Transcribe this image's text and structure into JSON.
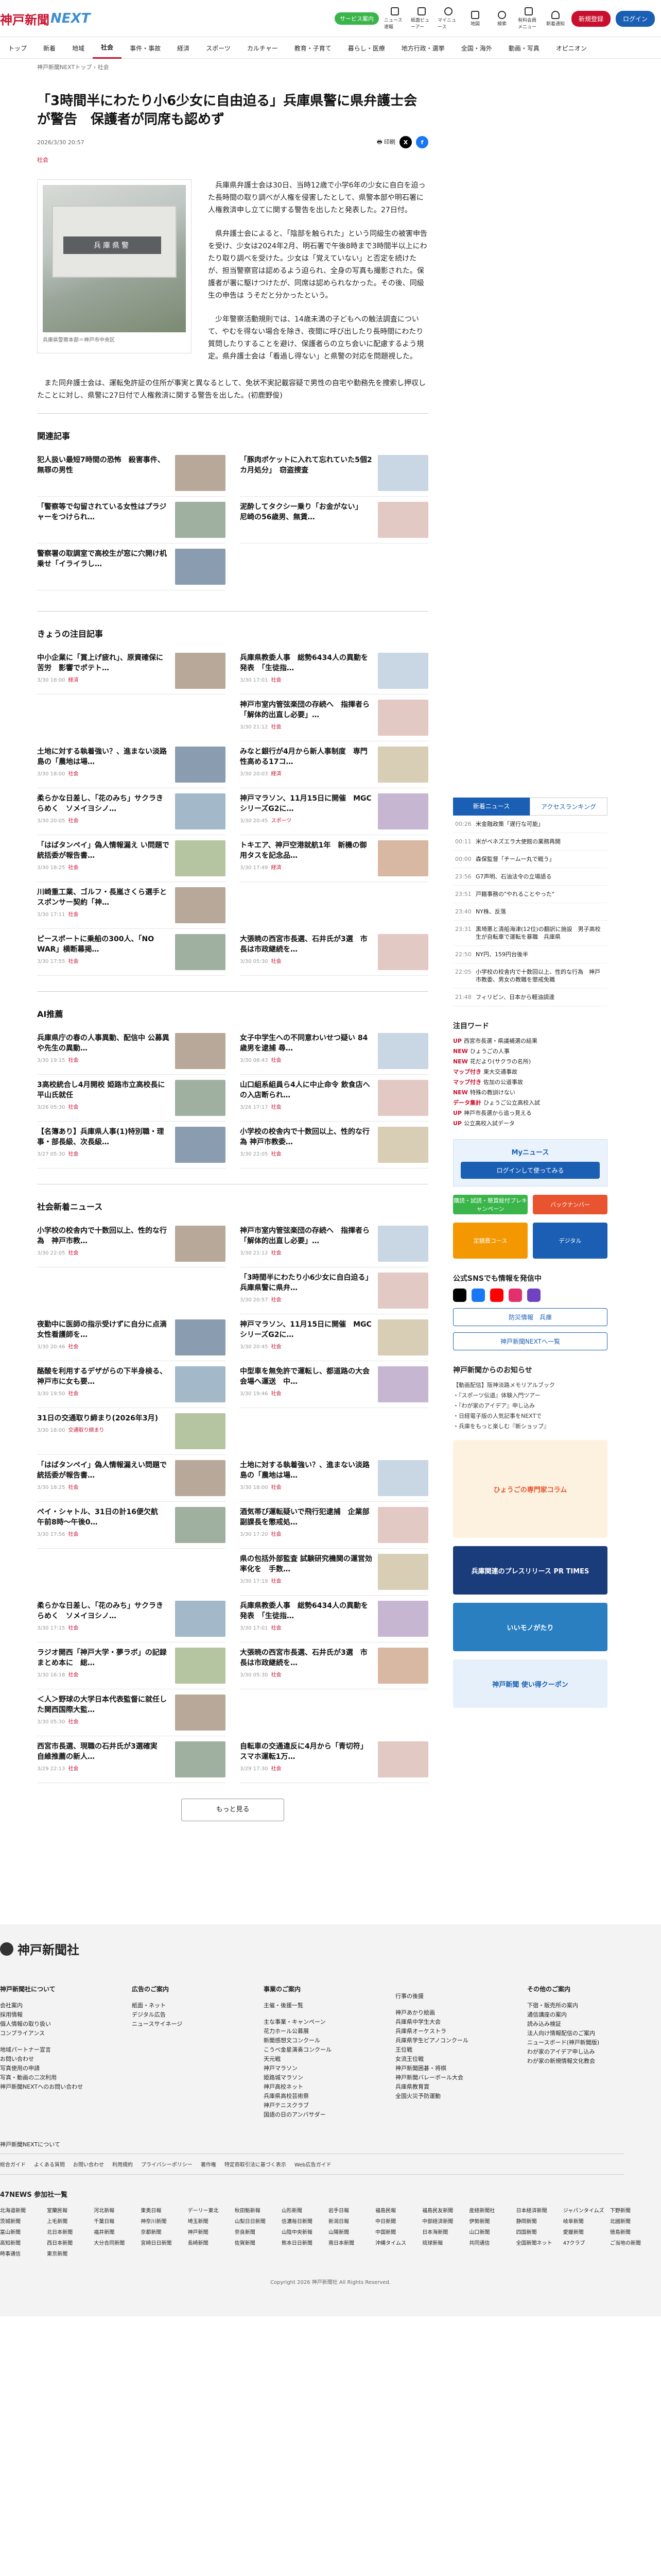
{
  "header": {
    "logo_main": "神戸新聞",
    "logo_next": "NEXT",
    "green_pill": "サービス案内",
    "icons": [
      "ニュース速報",
      "紙面ビューアー",
      "マイニュース",
      "地図",
      "検索",
      "有料会員メニュー",
      "新着通知"
    ],
    "register": "新規登録",
    "login": "ログイン"
  },
  "nav": [
    "トップ",
    "新着",
    "地域",
    "社会",
    "事件・事故",
    "経済",
    "スポーツ",
    "カルチャー",
    "教育・子育て",
    "暮らし・医療",
    "地方行政・選挙",
    "全国・海外",
    "動画・写真",
    "オピニオン"
  ],
  "breadcrumb": "神戸新聞NEXTトップ › 社会",
  "article": {
    "title": "「3時間半にわたり小6少女に自由迫る」兵庫県警に県弁護士会が警告　保護者が同席も認めず",
    "date": "2026/3/30 20:57",
    "print": "印刷",
    "category": "社会",
    "image_sign": "兵庫県警",
    "caption": "兵庫県警察本部＝神戸市中央区",
    "paragraphs": [
      "兵庫県弁護士会は30日、当時12歳で小学6年の少女に自白を迫った長時間の取り調べが人権を侵害したとして、県警本部や明石署に人権救済申し立てに関する警告を出したと発表した。27日付。",
      "県弁護士会によると、「陰部を触られた」という同級生の被害申告を受け、少女は2024年2月、明石署で午後8時まで3時間半以上にわたり取り調べを受けた。少女は「覚えていない」と否定を続けたが、担当警察官は認めるよう迫られ、全身の写真も撮影された。保護者が署に駆けつけたが、同席は認められなかった。その後、同級生の申告は うそだと分かったという。",
      "少年警察活動規則では、14歳未満の子どもへの触法調査について、やむを得ない場合を除き、夜間に呼び出したり長時間にわたり質問したりすることを避け、保護者らの立ち会いに配慮するよう規定。県弁護士会は「看過し得ない」と県警の対応を問題視した。"
    ],
    "paragraph_last": "また同弁護士会は、運転免許証の住所が事実と異なるとして、免状不実記載容疑で男性の自宅や勤務先を捜索し押収したことに対し、県警に27日付で人権救済に関する警告を出した。(初鹿野俊)"
  },
  "related": {
    "heading": "関連記事",
    "items": [
      {
        "title": "犯人扱い最短7時間の恐怖　殺害事件、無罪の男性",
        "meta": ""
      },
      {
        "title": "「豚肉ポケットに入れて忘れていた5個2カ月処分」　窃盗捜査",
        "meta": ""
      },
      {
        "title": "「警察等で勾留されている女性はプラジャーをつけられ…",
        "meta": ""
      },
      {
        "title": "泥酔してタクシー乗り「お金がない」　尼崎の56歳男、無賃…",
        "meta": ""
      },
      {
        "title": "警察署の取調室で高校生が窓に穴開け机乗せ「イライラし…",
        "meta": ""
      }
    ]
  },
  "attention": {
    "heading": "きょうの注目記事",
    "items": [
      {
        "title": "中小企業に「賞上げ疲れ」、原資確保に苦労　影響でポテト…",
        "meta": "3/30 16:00",
        "tag": "経済"
      },
      {
        "title": "兵庫県教委人事　総勢6434人の異動を発表　「生徒指…",
        "meta": "3/30 17:01",
        "tag": "社会"
      },
      {
        "title": "",
        "meta": "",
        "tag": ""
      },
      {
        "title": "神戸市室内管弦楽団の存続へ　指揮者ら「解体的出直し必要」…",
        "meta": "3/30 21:12",
        "tag": "社会"
      },
      {
        "title": "土地に対する執着強い？、進まない淡路島の「農地は場…",
        "meta": "3/30 18:00",
        "tag": "社会"
      },
      {
        "title": "みなと銀行が4月から新人事制度　専門性高める17コ…",
        "meta": "3/30 20:03",
        "tag": "経済"
      },
      {
        "title": "柔らかな日差し、「花のみち」サクラきらめく　ソメイヨシノ…",
        "meta": "3/30 20:05",
        "tag": "社会"
      },
      {
        "title": "神戸マラソン、11月15日に開催　MGCシリーズG2に…",
        "meta": "3/30 20:45",
        "tag": "スポーツ"
      },
      {
        "title": "「はばタンペイ」偽人情報漏え い問題で統括委が報告書…",
        "meta": "3/30 18:25",
        "tag": "社会"
      },
      {
        "title": "トキエア、神戸空港就航1年　新機の御用タスを記念品…",
        "meta": "3/30 17:49",
        "tag": "経済"
      },
      {
        "title": "川崎重工業、ゴルフ・長嵐さくら選手とスポンサー契約「神…",
        "meta": "3/30 17:11",
        "tag": "社会"
      },
      {
        "title": "",
        "meta": "",
        "tag": ""
      },
      {
        "title": "ピースポートに乗船の300人、「NO　WAR」横断幕掲…",
        "meta": "3/30 17:55",
        "tag": "社会"
      },
      {
        "title": "大張暁の西宮市長選、石井氏が3選　市長は市政継続を…",
        "meta": "3/30 05:30",
        "tag": "社会"
      }
    ]
  },
  "ai": {
    "heading": "AI推薦",
    "items": [
      {
        "title": "兵庫県庁の春の人事異動、配信中 公募異や先生の異動…",
        "meta": "3/30 19:15",
        "tag": "社会"
      },
      {
        "title": "女子中学生への不同意わいせつ疑い 84歳男を逮捕 尋…",
        "meta": "3/30 08:43",
        "tag": "社会"
      },
      {
        "title": "3高校統合し4月開校 姫路市立高校長に平山氏就任",
        "meta": "3/26 05:30",
        "tag": "社会"
      },
      {
        "title": "山口組系組員ら4人に中止命令 飲食店への入店断られ…",
        "meta": "3/26 17:17",
        "tag": "社会"
      },
      {
        "title": "【名簿あり】兵庫県人事(1)特別職・理事・部長級、次長級…",
        "meta": "3/27 05:30",
        "tag": "社会"
      },
      {
        "title": "小学校の校舎内で十数回以上、性的な行為 神戸市教委…",
        "meta": "3/30 22:05",
        "tag": "社会"
      }
    ]
  },
  "social": {
    "heading": "社会新着ニュース",
    "items": [
      {
        "title": "小学校の校舎内で十数回以上、性的な行為　神戸市教…",
        "meta": "3/30 22:05",
        "tag": "社会"
      },
      {
        "title": "神戸市室内管弦楽団の存続へ　指揮者ら「解体的出直し必要」…",
        "meta": "3/30 21:12",
        "tag": "社会"
      },
      {
        "title": "",
        "meta": "",
        "tag": ""
      },
      {
        "title": "「3時間半にわたり小6少女に自白迫る」兵庫県警に県弁…",
        "meta": "3/30 20:57",
        "tag": "社会"
      },
      {
        "title": "夜勤中に医師の指示受けずに自分に点滴　女性看護師を…",
        "meta": "3/30 20:46",
        "tag": "社会"
      },
      {
        "title": "神戸マラソン、11月15日に開催　MGCシリーズG2に…",
        "meta": "3/30 20:45",
        "tag": "社会"
      },
      {
        "title": "酪酸を利用するデザがらの下半身検る、神戸市に女も要…",
        "meta": "3/30 19:50",
        "tag": "社会"
      },
      {
        "title": "中型車を無免許で運転し、都道路の大会会場へ運送　中…",
        "meta": "3/30 19:46",
        "tag": "社会"
      },
      {
        "title": "31日の交通取り締まり(2026年3月)",
        "meta": "3/30 18:00",
        "tag": "交通取り締まり"
      },
      {
        "title": "",
        "meta": "",
        "tag": ""
      },
      {
        "title": "「はばタンペイ」偽人情報漏えい問題で統括委が報告書…",
        "meta": "3/30 18:25",
        "tag": "社会"
      },
      {
        "title": "土地に対する執着強い？、進まない淡路島の「農地は場…",
        "meta": "3/30 18:00",
        "tag": "社会"
      },
      {
        "title": "ペイ・シャトル、31日の計16便欠航　午前8時〜午後0…",
        "meta": "3/30 17:56",
        "tag": "社会"
      },
      {
        "title": "酒気帯び運転疑いで飛行犯逮捕　企業部副課長を懲戒処…",
        "meta": "3/30 17:20",
        "tag": "社会"
      },
      {
        "title": "",
        "meta": "",
        "tag": ""
      },
      {
        "title": "県の包括外部監査 試験研究機関の運営効率化を　手数…",
        "meta": "3/30 17:19",
        "tag": "社会"
      },
      {
        "title": "柔らかな日差し、「花のみち」サクラきらめく　ソメイヨシノ…",
        "meta": "3/30 17:15",
        "tag": "社会"
      },
      {
        "title": "兵庫県教委人事　総勢6434人の異動を発表　「生徒指…",
        "meta": "3/30 17:01",
        "tag": "社会"
      },
      {
        "title": "ラジオ開西「神戸大学・夢ラボ」の記録まとめ本に　総…",
        "meta": "3/30 16:18",
        "tag": "社会"
      },
      {
        "title": "大張暁の西宮市長選、石井氏が3選　市長は市政継続を…",
        "meta": "3/30 05:30",
        "tag": "社会"
      },
      {
        "title": "＜人＞野球の大学日本代表監督に就任した関西国際大監…",
        "meta": "3/30 05:30",
        "tag": "社会"
      },
      {
        "title": "",
        "meta": "",
        "tag": ""
      },
      {
        "title": "西宮市長選、現職の石井氏が3選確実　自維推薦の新人…",
        "meta": "3/29 22:13",
        "tag": "社会"
      },
      {
        "title": "自転車の交通違反に4月から「青切符」　スマホ運転1万…",
        "meta": "3/29 17:30",
        "tag": "社会"
      }
    ],
    "more": "もっと見る"
  },
  "sidebar": {
    "tab_new": "新着ニュース",
    "tab_rank": "アクセスランキング",
    "news": [
      {
        "time": "00:26",
        "text": "米金融政策「遅行な可能」"
      },
      {
        "time": "00:11",
        "text": "米がベネズエラ大使館の業務再開"
      },
      {
        "time": "00:00",
        "text": "森保監督「チーム一丸で戦う」"
      },
      {
        "time": "23:56",
        "text": "G7声明、石油法令の立場語る"
      },
      {
        "time": "23:51",
        "text": "戸籍事務の\"やれることやった\""
      },
      {
        "time": "23:40",
        "text": "NY株、反落"
      },
      {
        "time": "23:31",
        "text": "黒埼悪と清船海津(12位)の翻訳に施設　男子高校生が自転車で運転を暴職　兵庫県"
      },
      {
        "time": "22:50",
        "text": "NY円、159円台後半"
      },
      {
        "time": "22:05",
        "text": "小学校の校舎内で十数回以上、性的な行為　神戸市教委、男女の教職を懲戒免職"
      },
      {
        "time": "21:48",
        "text": "フィリピン、日本から軽油調達"
      }
    ],
    "kw_heading": "注目ワード",
    "keywords": [
      {
        "badge": "UP",
        "text": "西宮市長選・県議補選の結果"
      },
      {
        "badge": "NEW",
        "text": "ひょうごの人事"
      },
      {
        "badge": "NEW",
        "text": "花だより(サクラの名所)"
      },
      {
        "badge": "マップ付き",
        "text": "東大交通事故"
      },
      {
        "badge": "マップ付き",
        "text": "佐加の公道事故"
      },
      {
        "badge": "NEW",
        "text": "特殊の教訓けない"
      },
      {
        "badge": "データ集計",
        "text": "ひょうご公立高校入試"
      },
      {
        "badge": "UP",
        "text": "神戸市長選から追っ見える"
      },
      {
        "badge": "UP",
        "text": "公立高校入試データ"
      }
    ],
    "my_news_title": "Myニュース",
    "my_news_button": "ログインして使ってみる",
    "promo1": "購読・試読・懸賞総付プレキャンペーン",
    "promo2": "バックナンバー",
    "promo3": "定額費コース",
    "promo4": "デジタル",
    "sns_heading": "公式SNSでも情報を発信中",
    "btn_news": "防災情報　兵庫",
    "btn_next": "神戸新聞NEXTへ一覧",
    "links_heading": "神戸新聞からのお知らせ",
    "links": [
      "【動画配信】阪神淡路メモリアルブック",
      "・『スポーツ伝道』体験入門ツアー",
      "・『わが家のアイデア』申し込み",
      "・日経電子版の人気記事をNEXTで",
      "・兵庫をもっと楽しむ『新ショップ』"
    ],
    "banner1": "ひょうごの専門家コラム",
    "banner2": "兵庫関連のプレスリリース PR TIMES",
    "banner3": "いいモノがたり",
    "banner4": "神戸新聞 使い得クーポン"
  },
  "footer": {
    "logo": "神戸新聞社",
    "cols": [
      {
        "head": "神戸新聞社について",
        "items": [
          "会社案内",
          "採用情報",
          "個人情報の取り扱い",
          "コンプライアンス",
          "",
          "地域パートナー宣言",
          "お問い合わせ",
          "写真使用の申請",
          "写真・動画の二次利用",
          "神戸新聞NEXTへのお問い合わせ"
        ]
      },
      {
        "head": "広告のご案内",
        "items": [
          "紙面・ネット",
          "デジタル広告",
          "ニュースサイネージ"
        ]
      },
      {
        "head": "事業のご案内",
        "items": [
          "主催・後援一覧",
          "",
          "主な事業・キャンペーン",
          "花力ホール公募展",
          "新聞感想文コンクール",
          "こうべ金星演奏コンクール",
          "天元戦",
          "神戸マラソン",
          "姫路城マラソン",
          "神戸高校ネット",
          "兵庫県高校芸術祭",
          "神戸テニスクラブ",
          "国語の日のアンバサダー"
        ]
      },
      {
        "head": "",
        "items": [
          "行事の後援",
          "",
          "神戸あかり絵画",
          "兵庫県中学生大会",
          "兵庫県オーケストラ",
          "兵庫県学生ピアノコンクール",
          "王位戦",
          "女流王位戦",
          "神戸新聞囲碁・将棋",
          "神戸新聞バレーボール大会",
          "兵庫県教育賞",
          "全国火災予防運動"
        ]
      },
      {
        "head": "その他のご案内",
        "items": [
          "下宿・販売所の案内",
          "通信講座の案内",
          "読み込み検証",
          "法人向け情報配信のご案内",
          "ニュースボード(神戸新聞版)",
          "わが家のアイデア申し込み",
          "わが家の新規情報文化教会"
        ]
      }
    ],
    "next_label": "神戸新聞NEXTについて",
    "bar_links": [
      "総合ガイド",
      "よくある質問",
      "お問い合わせ",
      "利用規約",
      "プライバシーポリシー",
      "著作権",
      "特定商取引法に基づく表示",
      "Web広告ガイド"
    ],
    "partner_heading": "47NEWS 参加社一覧",
    "partners": [
      "北海道新聞",
      "室蘭民報",
      "河北新報",
      "東奥日報",
      "デーリー東北",
      "秋田魁新報",
      "山形新聞",
      "岩手日報",
      "福島民報",
      "福島民友新聞",
      "産経新聞社",
      "日本経済新聞",
      "ジャパンタイムズ",
      "下野新聞",
      "茨城新聞",
      "上毛新聞",
      "千葉日報",
      "神奈川新聞",
      "埼玉新聞",
      "山梨日日新聞",
      "信濃毎日新聞",
      "新潟日報",
      "中日新聞",
      "中部経済新聞",
      "伊勢新聞",
      "静岡新聞",
      "岐阜新聞",
      "北國新聞",
      "富山新聞",
      "北日本新聞",
      "福井新聞",
      "京都新聞",
      "神戸新聞",
      "奈良新聞",
      "山陰中央新報",
      "山陽新聞",
      "中国新聞",
      "日本海新聞",
      "山口新聞",
      "四国新聞",
      "愛媛新聞",
      "徳島新聞",
      "高知新聞",
      "西日本新聞",
      "大分合同新聞",
      "宮崎日日新聞",
      "長崎新聞",
      "佐賀新聞",
      "熊本日日新聞",
      "南日本新聞",
      "沖縄タイムス",
      "琉球新報",
      "共同通信",
      "全国新聞ネット",
      "47クラブ",
      "ご当地の新聞",
      "時事通信",
      "東京新聞"
    ],
    "copyright": "Copyright 2026 神戸新聞社 All Rights Reserved."
  }
}
